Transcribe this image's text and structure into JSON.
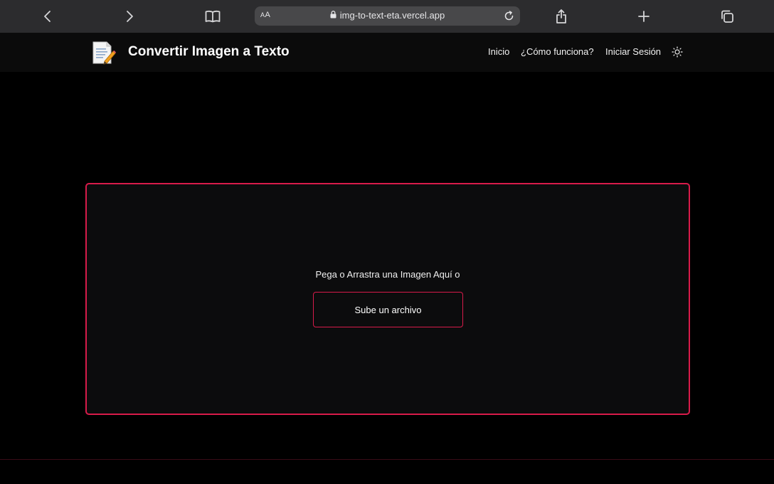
{
  "browser": {
    "address_prefix_large": "A",
    "address_prefix_small": "A",
    "url": "img-to-text-eta.vercel.app"
  },
  "header": {
    "title": "Convertir Imagen a Texto",
    "nav": [
      {
        "label": "Inicio"
      },
      {
        "label": "¿Cómo funciona?"
      },
      {
        "label": "Iniciar Sesión"
      }
    ],
    "theme_icon": "sun-icon"
  },
  "dropzone": {
    "prompt": "Pega o Arrastra una Imagen Aquí o",
    "upload_label": "Sube un archivo"
  },
  "colors": {
    "accent": "#d81b4a",
    "background": "#000000",
    "header_bg": "#0b0b0b",
    "browser_bar": "#2c2c2e"
  }
}
